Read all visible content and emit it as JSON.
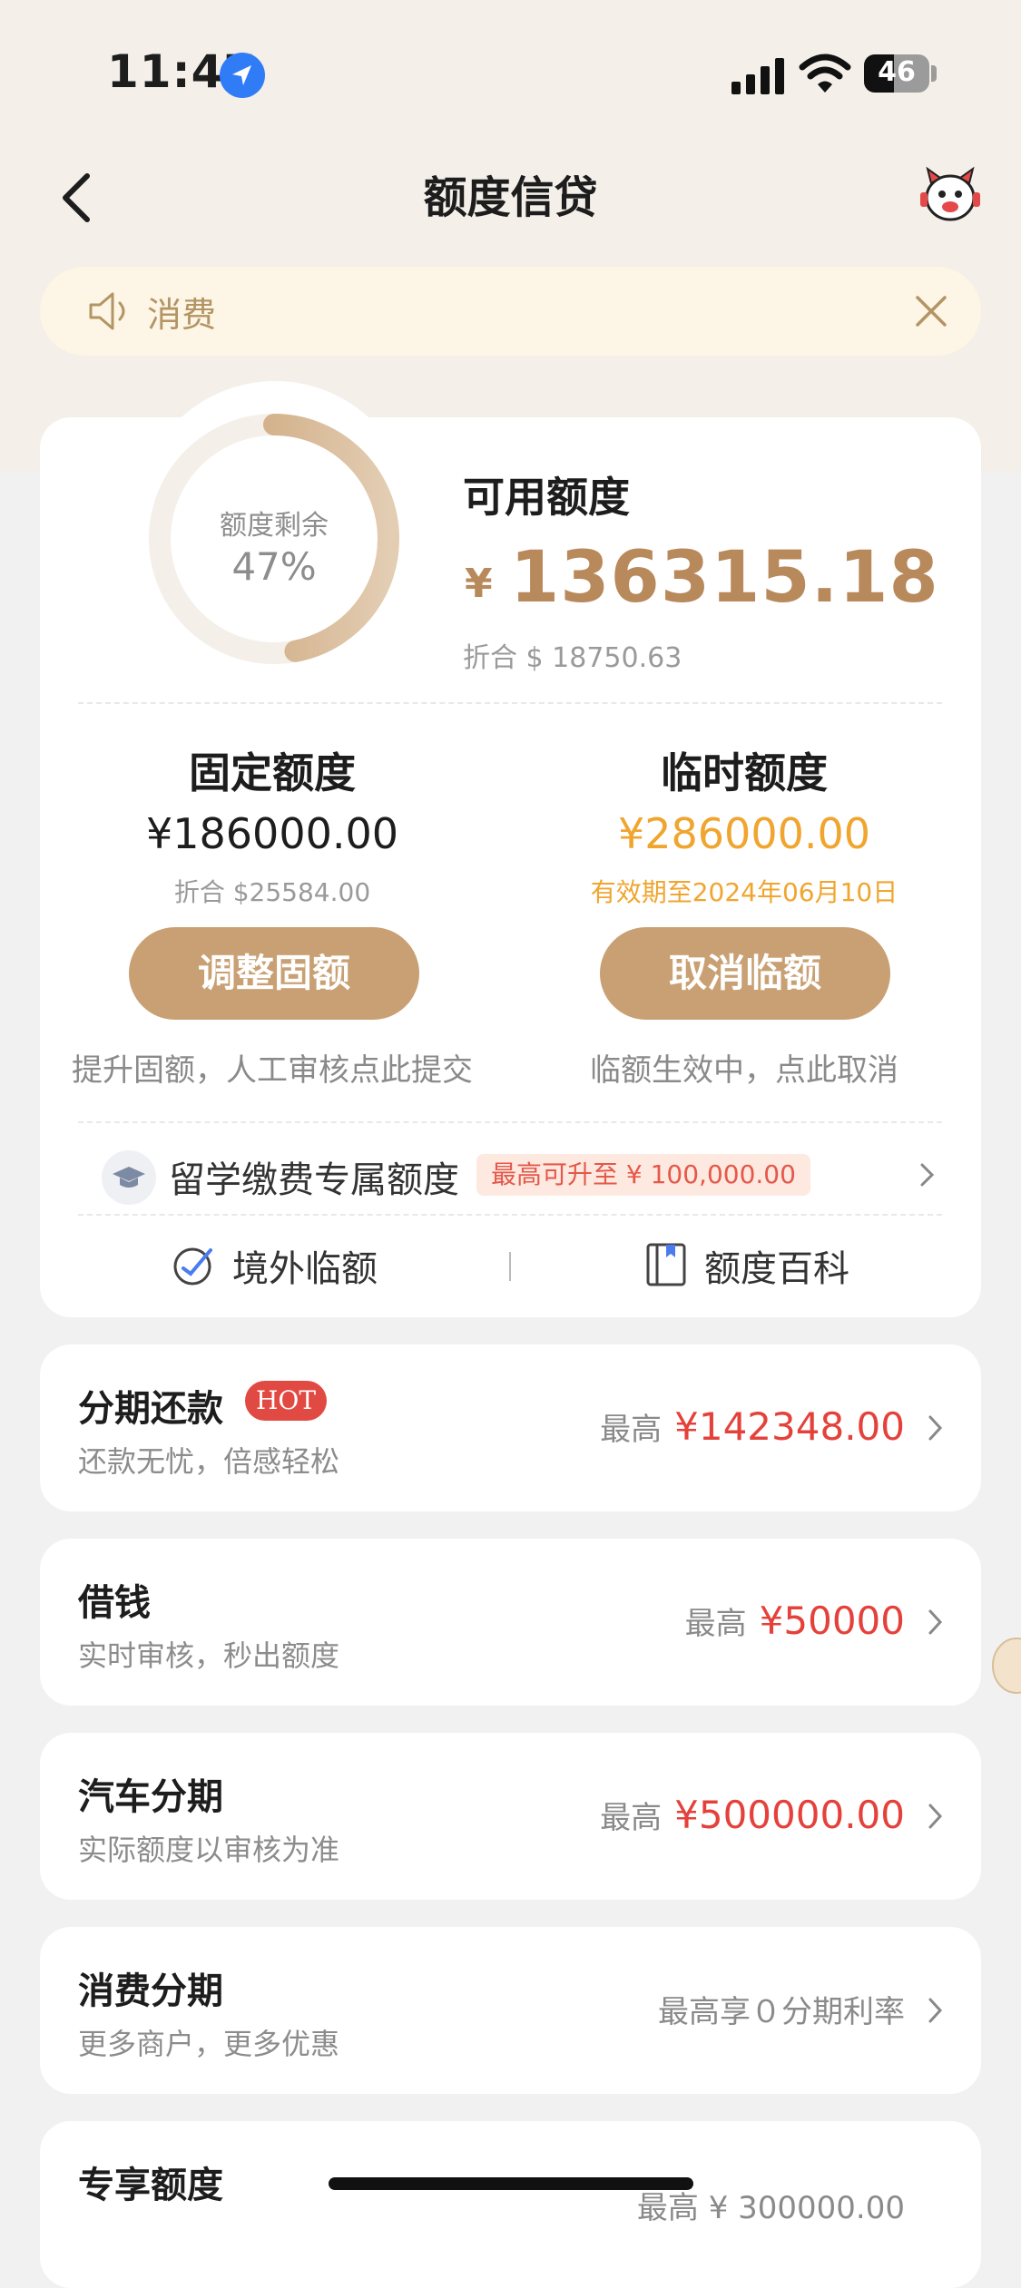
{
  "status_bar": {
    "time": "11:47",
    "battery": "46"
  },
  "nav": {
    "title": "额度信贷"
  },
  "notice": {
    "text": "消费"
  },
  "credit": {
    "ring_label": "额度剩余",
    "ring_percent": "47%",
    "ring_fraction": 0.47,
    "available_label": "可用额度",
    "available_symbol": "¥",
    "available_amount": "136315.18",
    "available_usd": "折合 $ 18750.63"
  },
  "fixed": {
    "title": "固定额度",
    "amount": "¥186000.00",
    "usd": "折合 $25584.00",
    "button": "调整固额",
    "note": "提升固额，人工审核点此提交"
  },
  "temp": {
    "title": "临时额度",
    "amount": "¥286000.00",
    "validity": "有效期至2024年06月10日",
    "button": "取消临额",
    "note": "临额生效中，点此取消"
  },
  "study": {
    "label": "留学缴费专属额度",
    "tag": "最高可升至 ¥ 100,000.00"
  },
  "links": {
    "left": "境外临额",
    "right": "额度百科"
  },
  "products": [
    {
      "title": "分期还款",
      "badge": "HOT",
      "subtitle": "还款无忧，倍感轻松",
      "prefix": "最高",
      "value": "¥142348.00"
    },
    {
      "title": "借钱",
      "subtitle": "实时审核，秒出额度",
      "prefix": "最高",
      "value": "¥50000"
    },
    {
      "title": "汽车分期",
      "subtitle": "实际额度以审核为准",
      "prefix": "最高",
      "value": "¥500000.00"
    },
    {
      "title": "消费分期",
      "subtitle": "更多商户，更多优惠",
      "prefix": "最高享０分期利率",
      "value": ""
    },
    {
      "title": "专享额度",
      "prefix": "最高 ¥ 300000.00",
      "value": ""
    }
  ],
  "colors": {
    "accent": "#c9a073",
    "gold_text": "#b8895b",
    "red": "#e5413b",
    "temp_orange": "#f0a52f"
  }
}
